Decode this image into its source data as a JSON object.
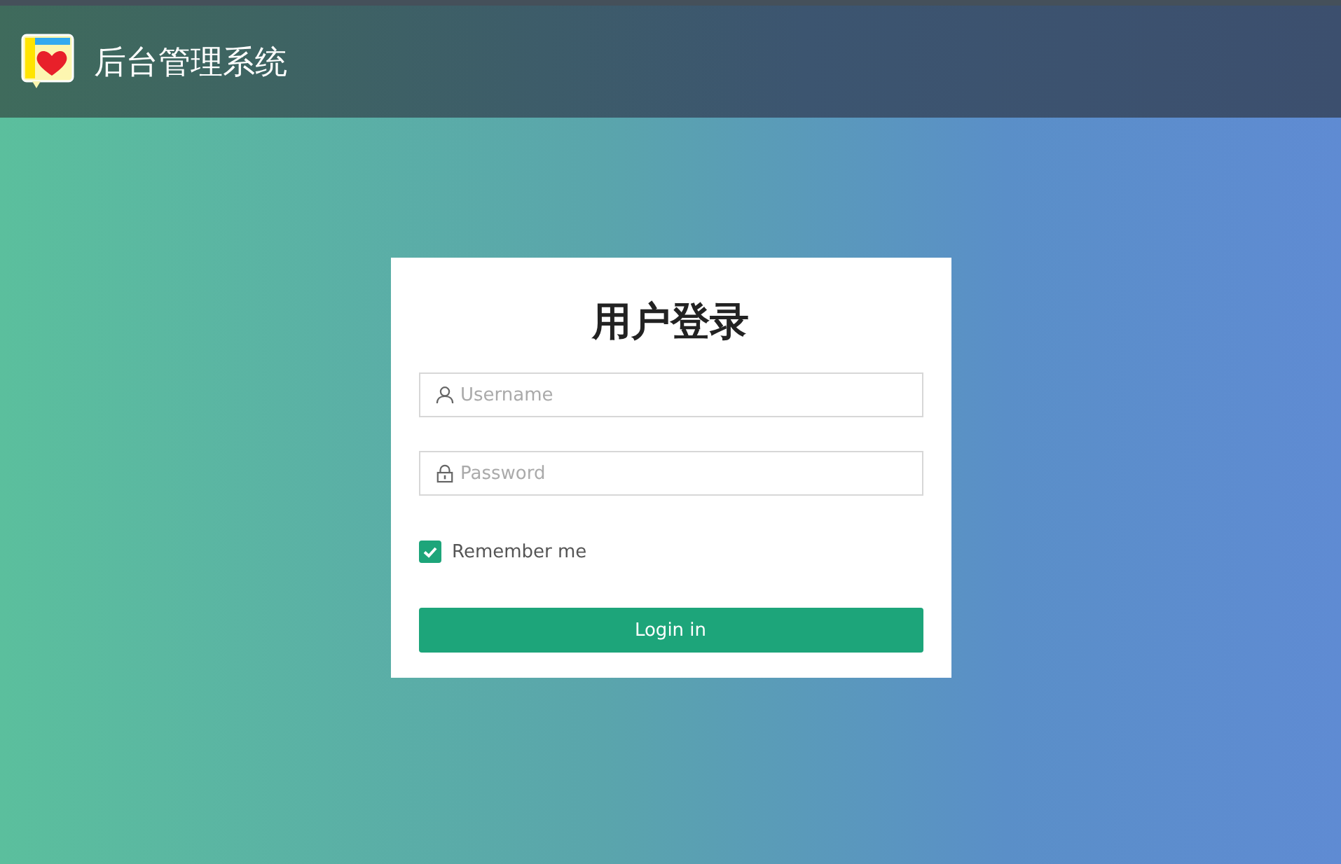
{
  "header": {
    "title": "后台管理系统"
  },
  "login": {
    "title": "用户登录",
    "username": {
      "placeholder": "Username"
    },
    "password": {
      "placeholder": "Password"
    },
    "remember": {
      "label": "Remember me",
      "checked": true
    },
    "button": "Login in"
  }
}
